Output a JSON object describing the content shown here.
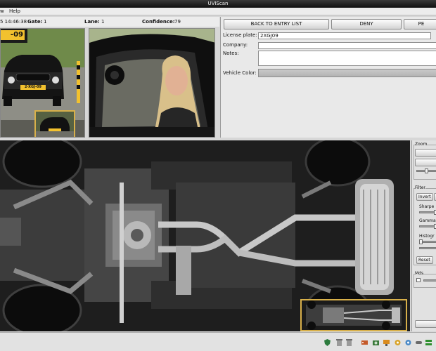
{
  "window": {
    "title": "UVIScan"
  },
  "menu": {
    "items": [
      "w",
      "Help"
    ]
  },
  "info": {
    "datetime": "5 14:46:38",
    "gate_label": "Gate:",
    "gate_value": "1",
    "lane_label": "Lane:",
    "lane_value": "1",
    "confidence_label": "Confidence:",
    "confidence_value": "79"
  },
  "plate_camera": {
    "plate_text": "-09",
    "car_plate_text": "2-XGJ-09"
  },
  "actions": {
    "back_label": "BACK TO ENTRY LIST",
    "deny_label": "DENY",
    "third_label": "PE"
  },
  "form": {
    "license_plate_label": "License plate:",
    "license_plate_value": "2XGJ09",
    "company_label": "Company:",
    "company_value": "",
    "notes_label": "Notes:",
    "notes_value": "",
    "vehicle_color_label": "Vehicle Color:"
  },
  "side_panel": {
    "zoom_label": "Zoom",
    "filter_label": "Filter",
    "invert_label": "Invert",
    "sharpen_label": "Sharpe",
    "gamma_label": "Gamma",
    "histogram_label": "Histogr",
    "reset_label": "Reset",
    "mds_label": "Mds"
  },
  "status_icons": [
    "shield-icon",
    "trash-icon",
    "trash-icon",
    "tag-icon",
    "camera-icon",
    "monitor-icon",
    "network-icon",
    "gear-icon",
    "link-icon",
    "flag-icon"
  ],
  "colors": {
    "accent_frame": "#d8b04a",
    "plate_yellow": "#f2c12e",
    "title_bar": "#1d1d1d"
  }
}
